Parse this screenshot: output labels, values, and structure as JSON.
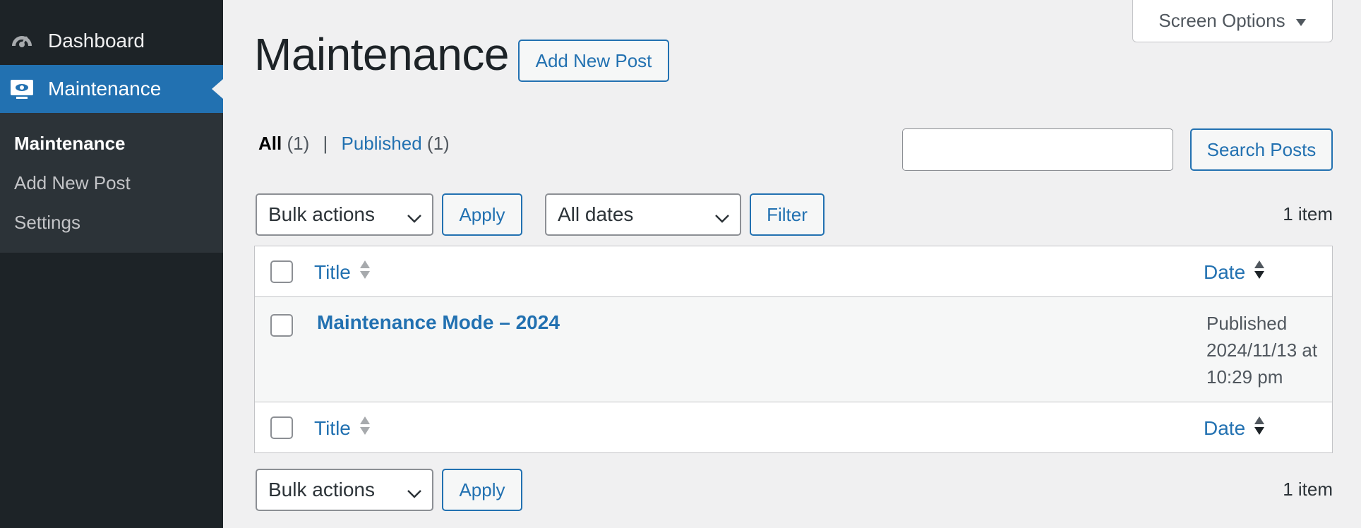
{
  "sidebar": {
    "dashboard_label": "Dashboard",
    "maintenance_label": "Maintenance",
    "submenu": [
      "Maintenance",
      "Add New Post",
      "Settings"
    ]
  },
  "header": {
    "screen_options": "Screen Options",
    "title": "Maintenance",
    "add_new": "Add New Post"
  },
  "filters": {
    "all_label": "All",
    "all_count": "(1)",
    "separator": "|",
    "published_label": "Published",
    "published_count": "(1)"
  },
  "search": {
    "value": "",
    "button": "Search Posts"
  },
  "tablenav": {
    "bulk_actions": "Bulk actions",
    "apply": "Apply",
    "dates": "All dates",
    "filter": "Filter",
    "count": "1 item"
  },
  "table": {
    "columns": [
      "Title",
      "Date"
    ],
    "rows": [
      {
        "title": "Maintenance Mode – 2024",
        "date_lines": [
          "Published",
          "2024/11/13 at",
          "10:29 pm"
        ]
      }
    ]
  },
  "colors": {
    "accent": "#2271b1",
    "sidebar_bg": "#1d2327",
    "submenu_bg": "#2c3338",
    "page_bg": "#f0f0f1"
  },
  "icons": {
    "dashboard": "dashboard-gauge-icon",
    "maintenance": "monitor-eye-icon",
    "screen_options_arrow": "triangle-down-icon",
    "select": "chevron-down-icon",
    "sort": "sort-arrows-icon"
  }
}
